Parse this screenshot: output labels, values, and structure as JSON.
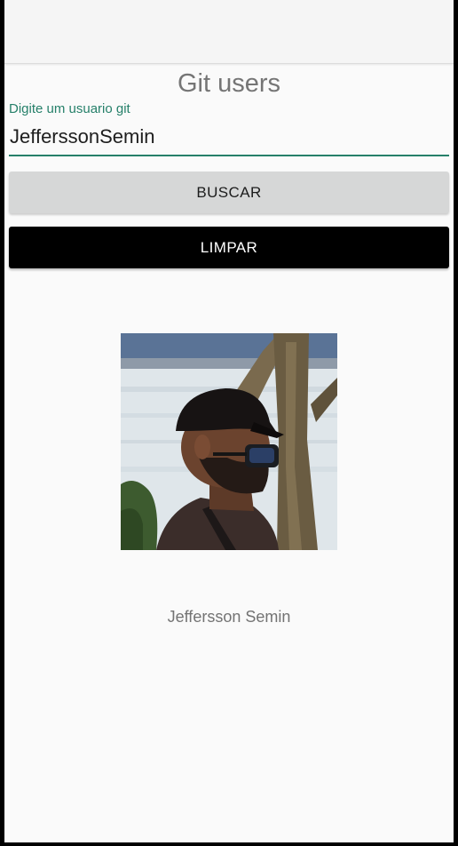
{
  "app": {
    "title": "Git users"
  },
  "search": {
    "label": "Digite um usuario git",
    "value": "JefferssonSemin"
  },
  "buttons": {
    "search_label": "BUSCAR",
    "clear_label": "LIMPAR"
  },
  "result": {
    "user_name": "Jeffersson Semin"
  },
  "colors": {
    "accent": "#26806a",
    "search_button_bg": "#d6d7d7",
    "clear_button_bg": "#000000",
    "background": "#fafafa"
  }
}
